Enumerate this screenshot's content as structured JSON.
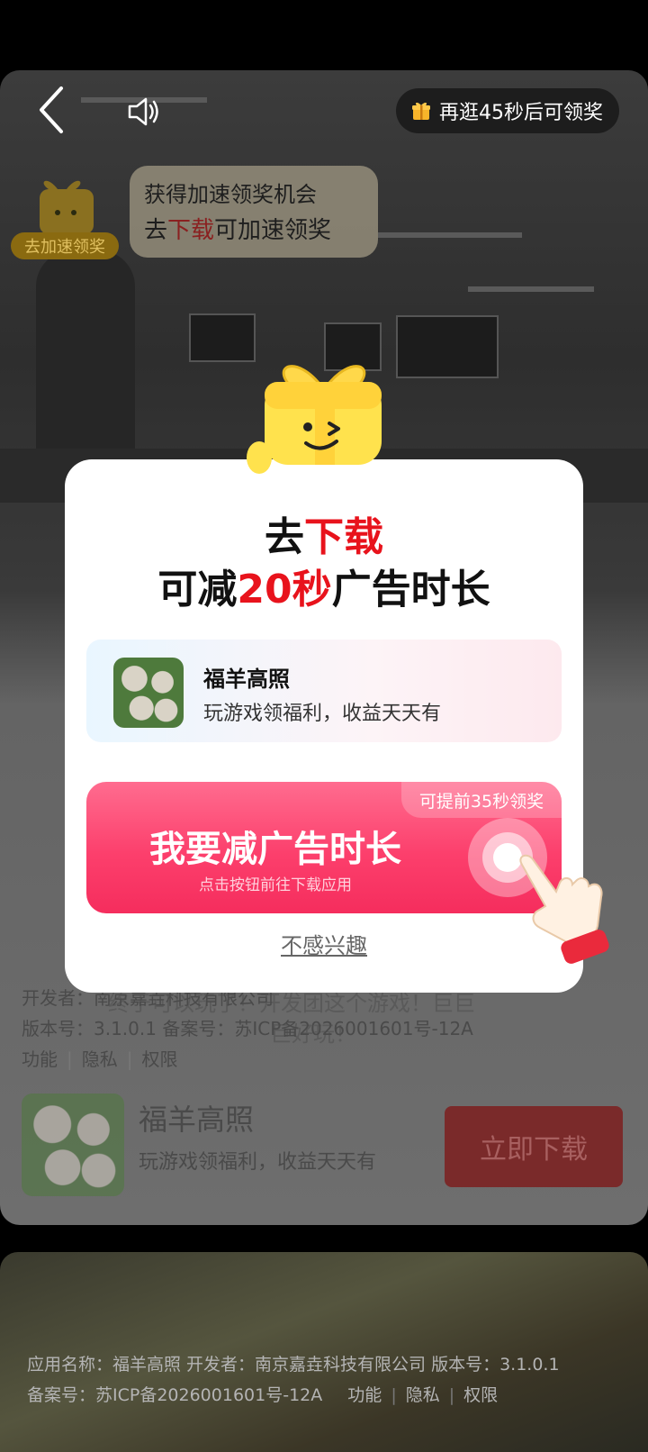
{
  "topbar": {
    "timer_text": "再逛45秒后可领奖"
  },
  "accelerate": {
    "badge_label": "去加速领奖",
    "line1": "获得加速领奖机会",
    "line2_pre": "去",
    "line2_highlight": "下载",
    "line2_post": "可加速领奖"
  },
  "modal": {
    "title1_pre": "去",
    "title1_highlight": "下载",
    "title2_pre": "可减",
    "title2_highlight": "20秒",
    "title2_post": "广告时长",
    "app_name": "福羊高照",
    "app_desc": "玩游戏领福利，收益天天有",
    "cta_badge": "可提前35秒领奖",
    "cta_label": "我要减广告时长",
    "cta_sub": "点击按钮前往下载应用",
    "dismiss": "不感兴趣"
  },
  "background_ad": {
    "overlay_text1": "终于可以玩了！开发团这个游戏！巨巨",
    "overlay_text2": "巨好玩！",
    "developer_label": "开发者：南京嘉垚科技有限公司",
    "version_line": "版本号：3.1.0.1    备案号：苏ICP备2026001601号-12A",
    "links": [
      "功能",
      "隐私",
      "权限"
    ],
    "app_name": "福羊高照",
    "app_desc": "玩游戏领福利，收益天天有",
    "download_button": "立即下载"
  },
  "footer": {
    "line1": "应用名称：福羊高照    开发者：南京嘉垚科技有限公司    版本号：3.1.0.1",
    "record": "备案号：苏ICP备2026001601号-12A",
    "links": [
      "功能",
      "隐私",
      "权限"
    ]
  },
  "colors": {
    "accent_red": "#e8131c",
    "cta_pink": "#fc3f6c",
    "modal_bg": "#ffffff"
  }
}
